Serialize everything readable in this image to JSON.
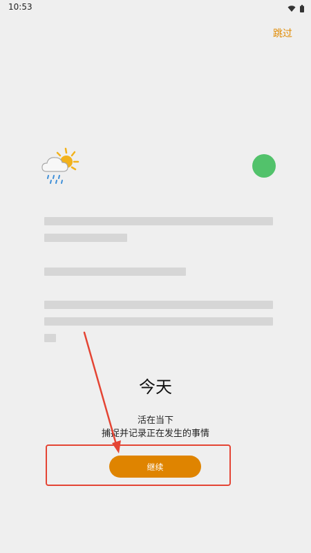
{
  "status_bar": {
    "time": "10:53",
    "icons": [
      "wifi-icon",
      "battery-icon"
    ]
  },
  "header": {
    "skip_label": "跳过"
  },
  "illustration": {
    "weather_icon": "partly-cloudy-rain-icon",
    "status_dot_color": "#52c26b"
  },
  "intro": {
    "title": "今天",
    "subtitle_line1": "活在当下",
    "subtitle_line2": "捕捉并记录正在发生的事情"
  },
  "actions": {
    "continue_label": "继续"
  },
  "colors": {
    "accent": "#df8400",
    "annotation": "#e44433"
  }
}
